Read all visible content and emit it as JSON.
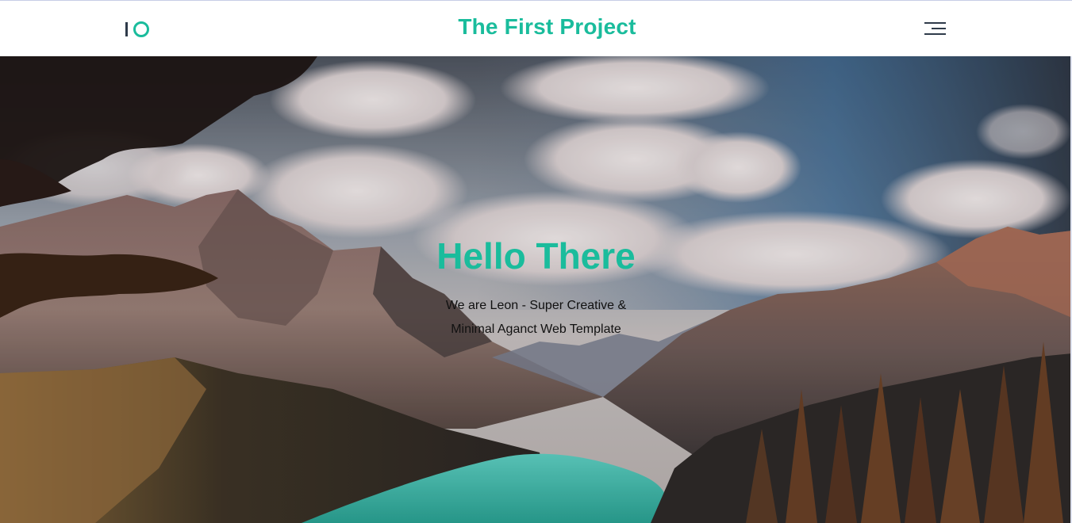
{
  "header": {
    "logo_icon": "io-logo-icon",
    "title": "The First Project",
    "menu_icon": "hamburger-menu-icon"
  },
  "hero": {
    "title": "Hello There",
    "subtitle": "We are Leon - Super Creative & Minimal Aganct Web Template",
    "background": "mountain-lake-landscape-image"
  },
  "colors": {
    "accent": "#1abc9c",
    "dark": "#2f3b4a",
    "text": "#111111"
  }
}
